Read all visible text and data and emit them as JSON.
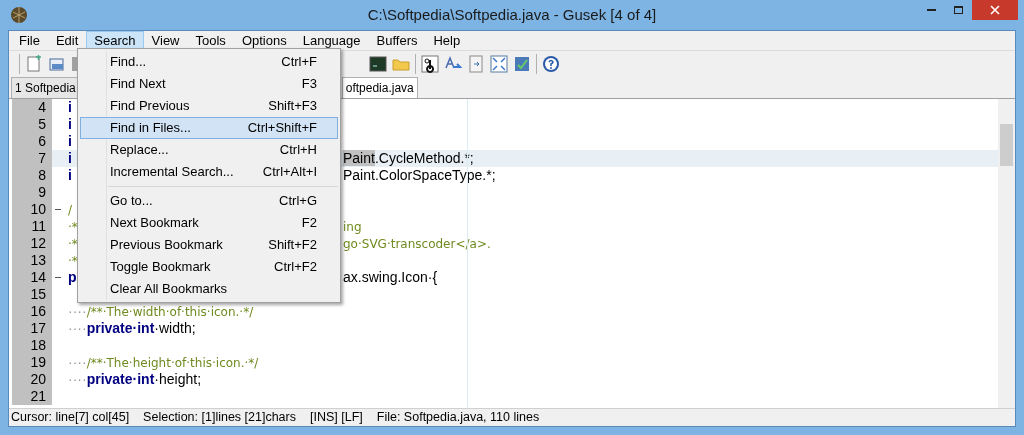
{
  "window": {
    "title": "C:\\Softpedia\\Softpedia.java - Gusek [4 of 4]"
  },
  "menubar": [
    {
      "label": "File",
      "selected": false
    },
    {
      "label": "Edit",
      "selected": false
    },
    {
      "label": "Search",
      "selected": true
    },
    {
      "label": "View",
      "selected": false
    },
    {
      "label": "Tools",
      "selected": false
    },
    {
      "label": "Options",
      "selected": false
    },
    {
      "label": "Language",
      "selected": false
    },
    {
      "label": "Buffers",
      "selected": false
    },
    {
      "label": "Help",
      "selected": false
    }
  ],
  "tabs": [
    {
      "label": "1 Softpedia",
      "selected": false
    },
    {
      "label": "oftpedia.java",
      "selected": true
    }
  ],
  "search_menu": [
    {
      "kind": "item",
      "label": "Find...",
      "shortcut": "Ctrl+F",
      "selected": false
    },
    {
      "kind": "item",
      "label": "Find Next",
      "shortcut": "F3",
      "selected": false
    },
    {
      "kind": "item",
      "label": "Find Previous",
      "shortcut": "Shift+F3",
      "selected": false
    },
    {
      "kind": "item",
      "label": "Find in Files...",
      "shortcut": "Ctrl+Shift+F",
      "selected": true
    },
    {
      "kind": "item",
      "label": "Replace...",
      "shortcut": "Ctrl+H",
      "selected": false
    },
    {
      "kind": "item",
      "label": "Incremental Search...",
      "shortcut": "Ctrl+Alt+I",
      "selected": false
    },
    {
      "kind": "separator"
    },
    {
      "kind": "item",
      "label": "Go to...",
      "shortcut": "Ctrl+G",
      "selected": false
    },
    {
      "kind": "item",
      "label": "Next Bookmark",
      "shortcut": "F2",
      "selected": false
    },
    {
      "kind": "item",
      "label": "Previous Bookmark",
      "shortcut": "Shift+F2",
      "selected": false
    },
    {
      "kind": "item",
      "label": "Toggle Bookmark",
      "shortcut": "Ctrl+F2",
      "selected": false
    },
    {
      "kind": "item",
      "label": "Clear All Bookmarks",
      "selected": false
    }
  ],
  "editor": {
    "lines": [
      {
        "number": "4",
        "foldable": false,
        "current": false,
        "left": [
          {
            "kind": "keyword",
            "text": "i"
          }
        ]
      },
      {
        "number": "5",
        "foldable": false,
        "current": false,
        "left": [
          {
            "kind": "keyword",
            "text": "i"
          }
        ]
      },
      {
        "number": "6",
        "foldable": false,
        "current": false,
        "left": [
          {
            "kind": "keyword",
            "text": "i"
          }
        ]
      },
      {
        "number": "7",
        "foldable": false,
        "current": true,
        "left": [
          {
            "kind": "keyword",
            "text": "i"
          }
        ],
        "right": [
          {
            "kind": "selected",
            "text": "Paint"
          },
          {
            "kind": "plain",
            "text": ".CycleMethod.*;"
          }
        ]
      },
      {
        "number": "8",
        "foldable": false,
        "current": false,
        "left": [
          {
            "kind": "keyword",
            "text": "i"
          }
        ],
        "right": [
          {
            "kind": "plain",
            "text": "Paint.ColorSpaceType.*;"
          }
        ]
      },
      {
        "number": "9",
        "foldable": false,
        "current": false
      },
      {
        "number": "10",
        "foldable": true,
        "current": false,
        "left": [
          {
            "kind": "comment",
            "text": "/"
          }
        ]
      },
      {
        "number": "11",
        "foldable": false,
        "current": false,
        "left": [
          {
            "kind": "comment",
            "text": "·*"
          }
        ],
        "right": [
          {
            "kind": "comment",
            "text": "ing"
          }
        ]
      },
      {
        "number": "12",
        "foldable": false,
        "current": false,
        "left": [
          {
            "kind": "comment",
            "text": "·*"
          }
        ],
        "right": [
          {
            "kind": "comment",
            "text": "go·SVG·transcoder</a>."
          }
        ]
      },
      {
        "number": "13",
        "foldable": false,
        "current": false,
        "left": [
          {
            "kind": "comment",
            "text": "·*"
          }
        ]
      },
      {
        "number": "14",
        "foldable": true,
        "current": false,
        "left": [
          {
            "kind": "keyword",
            "text": "p"
          }
        ],
        "right": [
          {
            "kind": "plain",
            "text": "ax.swing.Icon·{"
          }
        ]
      },
      {
        "number": "15",
        "foldable": false,
        "current": false
      },
      {
        "number": "16",
        "foldable": false,
        "current": false,
        "left": [
          {
            "kind": "space",
            "text": "····"
          },
          {
            "kind": "comment",
            "text": "/**·The·width·of·this·icon.·*/"
          }
        ]
      },
      {
        "number": "17",
        "foldable": false,
        "current": false,
        "left": [
          {
            "kind": "space",
            "text": "····"
          },
          {
            "kind": "keyword",
            "text": "private·int"
          },
          {
            "kind": "plain",
            "text": "·width;"
          }
        ]
      },
      {
        "number": "18",
        "foldable": false,
        "current": false
      },
      {
        "number": "19",
        "foldable": false,
        "current": false,
        "left": [
          {
            "kind": "space",
            "text": "····"
          },
          {
            "kind": "comment",
            "text": "/**·The·height·of·this·icon.·*/"
          }
        ]
      },
      {
        "number": "20",
        "foldable": false,
        "current": false,
        "left": [
          {
            "kind": "space",
            "text": "····"
          },
          {
            "kind": "keyword",
            "text": "private·int"
          },
          {
            "kind": "plain",
            "text": "·height;"
          }
        ]
      },
      {
        "number": "21",
        "foldable": false,
        "current": false
      }
    ]
  },
  "status_bar": [
    "Cursor: line[7] col[45]",
    "Selection: [1]lines [21]chars",
    "[INS] [LF]",
    "File: Softpedia.java, 110 lines"
  ]
}
